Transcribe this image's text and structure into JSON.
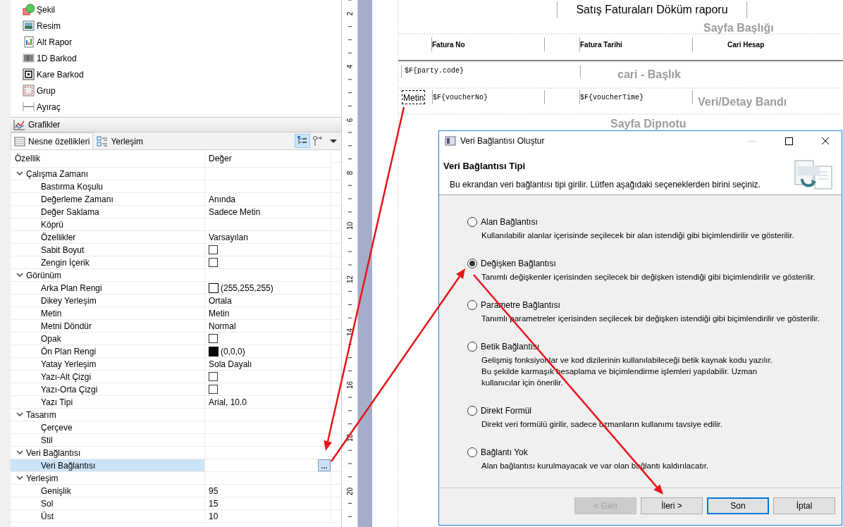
{
  "palette": {
    "items": [
      {
        "label": "Şekil",
        "kind": "shape"
      },
      {
        "label": "Resim",
        "kind": "image"
      },
      {
        "label": "Alt Rapor",
        "kind": "subreport"
      },
      {
        "label": "1D Barkod",
        "kind": "barcode"
      },
      {
        "label": "Kare Barkod",
        "kind": "qrcode"
      },
      {
        "label": "Grup",
        "kind": "group"
      },
      {
        "label": "Ayıraç",
        "kind": "separator"
      }
    ],
    "section": {
      "label": "Grafikler"
    }
  },
  "properties_view": {
    "tabs": [
      {
        "label": "Nesne özellikleri",
        "kind": "table",
        "selected": true
      },
      {
        "label": "Yerleşim",
        "kind": "layout",
        "selected": false
      }
    ],
    "toolbar": [
      {
        "kind": "tree",
        "selected": true
      },
      {
        "kind": "pin",
        "selected": false
      },
      {
        "kind": "menu",
        "selected": false
      }
    ],
    "columns": [
      "Özellik",
      "Değer"
    ],
    "groups": [
      {
        "label": "Çalışma Zamanı",
        "expanded": true,
        "children": [
          {
            "label": "Bastırma Koşulu",
            "kind": "text",
            "selected": false
          },
          {
            "label": "Değerleme Zamanı",
            "kind": "text",
            "value": "Anında",
            "selected": false
          },
          {
            "label": "Değer Saklama",
            "kind": "text",
            "value": "Sadece Metin",
            "selected": false
          },
          {
            "label": "Köprü",
            "kind": "text",
            "selected": false
          },
          {
            "label": "Özellikler",
            "kind": "text",
            "value": "Varsayılan",
            "selected": false
          },
          {
            "label": "Sabit Boyut",
            "kind": "checkbox",
            "checked": false,
            "selected": false
          },
          {
            "label": "Zengin İçerik",
            "kind": "checkbox",
            "checked": false,
            "selected": false
          }
        ]
      },
      {
        "label": "Görünüm",
        "expanded": true,
        "children": [
          {
            "label": "Arka Plan Rengi",
            "kind": "color",
            "color": "#ffffff",
            "value": "(255,255,255)",
            "selected": false
          },
          {
            "label": "Dikey Yerleşim",
            "kind": "text",
            "value": "Ortala",
            "selected": false
          },
          {
            "label": "Metin",
            "kind": "text",
            "value": "Metin",
            "selected": false
          },
          {
            "label": "Metni Döndür",
            "kind": "text",
            "value": "Normal",
            "selected": false
          },
          {
            "label": "Opak",
            "kind": "checkbox",
            "checked": false,
            "selected": false
          },
          {
            "label": "Ön Plan Rengi",
            "kind": "color",
            "color": "#000000",
            "value": "(0,0,0)",
            "selected": false
          },
          {
            "label": "Yatay Yerleşim",
            "kind": "text",
            "value": "Sola Dayalı",
            "selected": false
          },
          {
            "label": "Yazı-Alt Çizgi",
            "kind": "checkbox",
            "checked": false,
            "selected": false
          },
          {
            "label": "Yazı-Orta Çizgi",
            "kind": "checkbox",
            "checked": false,
            "selected": false
          },
          {
            "label": "Yazı Tipi",
            "kind": "text",
            "value": "Arial, 10.0",
            "selected": false
          }
        ]
      },
      {
        "label": "Tasarım",
        "expanded": true,
        "children": [
          {
            "label": "Çerçeve",
            "kind": "text",
            "selected": false
          },
          {
            "label": "Stil",
            "kind": "text",
            "selected": false
          }
        ]
      },
      {
        "label": "Veri Bağlantısı",
        "expanded": true,
        "children": [
          {
            "label": "Veri Bağlantısı",
            "kind": "button",
            "button": "...",
            "selected": true
          }
        ]
      },
      {
        "label": "Yerleşim",
        "expanded": true,
        "children": [
          {
            "label": "Genişlik",
            "kind": "text",
            "value": "95",
            "selected": false
          },
          {
            "label": "Sol",
            "kind": "text",
            "value": "15",
            "selected": false
          },
          {
            "label": "Üst",
            "kind": "text",
            "value": "10",
            "selected": false
          }
        ]
      }
    ]
  },
  "ruler": {
    "labels": [
      "2",
      "4",
      "6",
      "8",
      "10",
      "12",
      "14",
      "16",
      "18",
      "20"
    ]
  },
  "report": {
    "title": "Satış Faturaları Döküm raporu",
    "bands": [
      "Sayfa Başlığı",
      "cari - Başlık",
      "Veri/Detay Bandı",
      "Sayfa Dipnotu"
    ],
    "headers": [
      "Fatura No",
      "Fatura Tarihi",
      "Cari Hesap"
    ],
    "group_field": "$F{party.code}",
    "detail": [
      {
        "text": "Metin",
        "kind": "static",
        "selected": true
      },
      {
        "text": "$F{voucherNo}",
        "kind": "field",
        "selected": false
      },
      {
        "text": "$F{voucherTime}",
        "kind": "field",
        "selected": false
      }
    ]
  },
  "dialog": {
    "title": "Veri Bağlantısı Oluştur",
    "heading": "Veri Bağlantısı Tipi",
    "description": "Bu ekrandan veri bağlantısı tipi girilir. Lütfen aşağıdaki seçeneklerden birini seçiniz.",
    "options": [
      {
        "label": "Alan Bağlantısı",
        "description": "Kullanılabilir alanlar içerisinde seçilecek bir alan istendiği gibi biçimlendirilir ve gösterilir.",
        "selected": false
      },
      {
        "label": "Değişken Bağlantısı",
        "description": "Tanımlı değişkenler içerisinden seçilecek bir değişken istendiği gibi biçimlendirilir ve gösterilir.",
        "selected": true
      },
      {
        "label": "Parametre Bağlantısı",
        "description": "Tanımlı parametreler içerisinden seçilecek bir değişken istendiği gibi biçimlendirilir ve gösterilir.",
        "selected": false
      },
      {
        "label": "Betik Bağlantısı",
        "description": "Gelişmiş fonksiyonlar ve kod dizilerinin kullanılabileceği betik kaynak kodu yazılır.\nBu şekilde karmaşık hesaplama ve biçimlendirme işlemleri yapılabilir. Uzman\nkullanıcılar için önerilir.",
        "selected": false
      },
      {
        "label": "Direkt Formül",
        "description": "Direkt veri formülü girilir, sadece uzmanların kullanımı tavsiye edilir.",
        "selected": false
      },
      {
        "label": "Bağlantı Yok",
        "description": "Alan bağlantısı kurulmayacak ve var olan bağlantı kaldırılacatır.",
        "selected": false
      }
    ],
    "buttons": [
      {
        "label": "< Geri",
        "disabled": true,
        "default": false
      },
      {
        "label": "İleri >",
        "disabled": false,
        "default": false
      },
      {
        "label": "Son",
        "disabled": false,
        "default": true
      },
      {
        "label": "İptal",
        "disabled": false,
        "default": false
      }
    ]
  },
  "annotation_arrows": [
    {
      "color": "#e8141a"
    },
    {
      "color": "#e8141a"
    },
    {
      "color": "#e8141a"
    }
  ]
}
